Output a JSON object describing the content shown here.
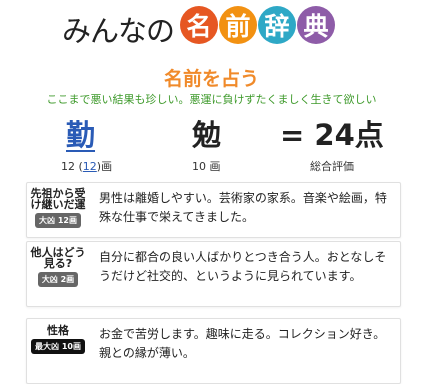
{
  "logo": {
    "kana": "みんなの",
    "circles": [
      "名",
      "前",
      "辞",
      "典"
    ]
  },
  "heading": {
    "title": "名前を占う",
    "subtitle": "ここまで悪い結果も珍しい。悪運に負けずたくましく生きて欲しい"
  },
  "name_chars": [
    {
      "char": "勤",
      "strokes_prefix": "12 (",
      "strokes_link": "12",
      "strokes_suffix": ")画"
    },
    {
      "char": "勉",
      "strokes_text": "10 画"
    }
  ],
  "total": {
    "text": "= 24点",
    "label": "総合評価"
  },
  "cards": [
    {
      "label": "先祖から受け継いだ運",
      "badge": "大凶 12画",
      "text": "男性は離婚しやすい。芸術家の家系。音楽や絵画，特殊な仕事で栄えてきました。"
    },
    {
      "label": "他人はどう見る?",
      "badge": "大凶 2画",
      "text": "自分に都合の良い人ばかりとつき合う人。おとなしそうだけど社交的、というように見られています。"
    },
    {
      "label": "性格",
      "badge": "最大凶 10画",
      "text": "お金で苦労します。趣味に走る。コレクション好き。親との縁が薄い。"
    }
  ],
  "colors": {
    "title": "#f08a2a",
    "subtitle": "#3e9a2b",
    "link": "#2a5bb6",
    "logo_circles": [
      "#e65722",
      "#f29112",
      "#2ea8c6",
      "#8e5ca8"
    ]
  }
}
